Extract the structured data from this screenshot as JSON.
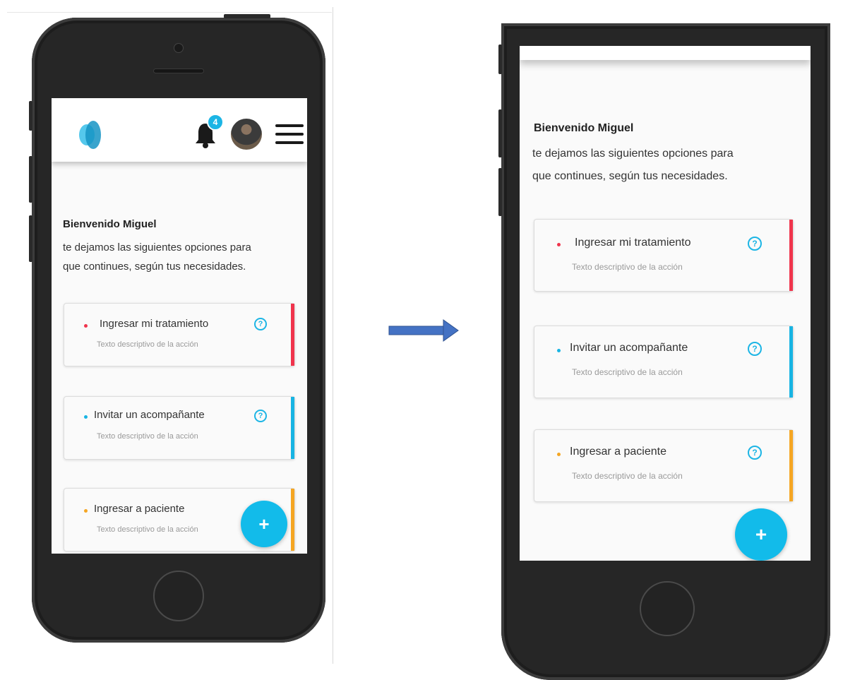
{
  "app": {
    "welcome": "Bienvenido Miguel",
    "intro_line1": "te dejamos las siguientes opciones para",
    "intro_line2": "que continues, según tus necesidades.",
    "notification_count": "4",
    "fab_label": "+",
    "help_glyph": "?",
    "actions": [
      {
        "title": "Ingresar mi tratamiento",
        "description": "Texto descriptivo de la acción",
        "accent": "#f0344c"
      },
      {
        "title": "Invitar un acompañante",
        "description": "Texto descriptivo de la acción",
        "accent": "#18b4e3"
      },
      {
        "title": "Ingresar a paciente",
        "description": "Texto descriptivo de la acción",
        "accent": "#f5a623"
      }
    ]
  },
  "colors": {
    "brand": "#1cb5e5",
    "fab": "#12bbea",
    "arrow": "#4472c4"
  },
  "icons": {
    "logo": "app-logo-icon",
    "bell": "bell-icon",
    "menu": "hamburger-menu-icon",
    "help": "help-circle-icon",
    "arrow": "right-arrow-icon"
  }
}
